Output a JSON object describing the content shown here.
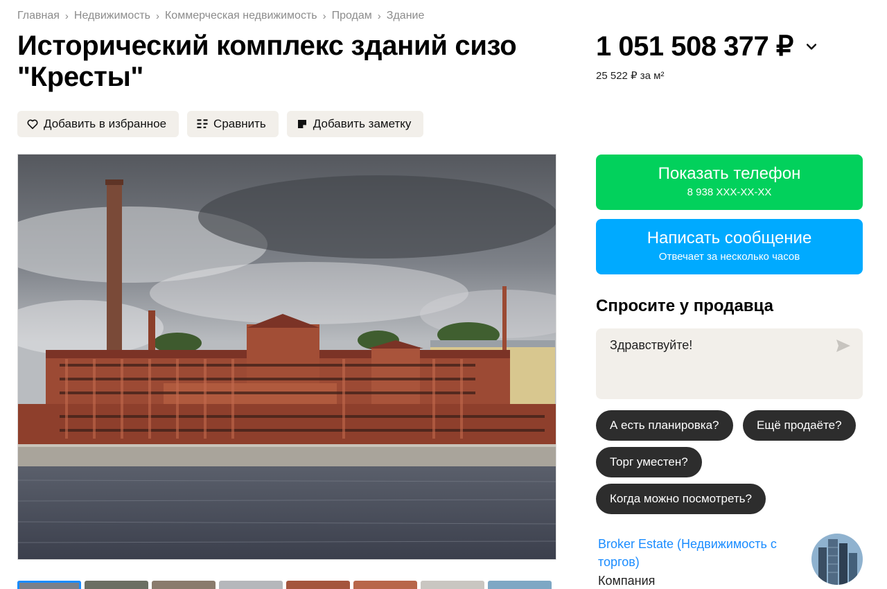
{
  "breadcrumb": [
    {
      "label": "Главная"
    },
    {
      "label": "Недвижимость"
    },
    {
      "label": "Коммерческая недвижимость"
    },
    {
      "label": "Продам"
    },
    {
      "label": "Здание"
    }
  ],
  "breadcrumb_separator": "›",
  "title": "Исторический комплекс зданий сизо \"Кресты\"",
  "actions": {
    "favorite": {
      "label": "Добавить в избранное",
      "icon": "heart-icon"
    },
    "compare": {
      "label": "Сравнить",
      "icon": "compare-icon"
    },
    "note": {
      "label": "Добавить заметку",
      "icon": "note-icon"
    }
  },
  "price": {
    "value": "1 051 508 377 ₽",
    "per_sqm": "25 522 ₽ за м²"
  },
  "phone_button": {
    "label": "Показать телефон",
    "number": "8 938 XXX-XX-XX",
    "color": "#02d15c"
  },
  "message_button": {
    "label": "Написать сообщение",
    "subtitle": "Отвечает за несколько часов",
    "color": "#00aaff"
  },
  "ask_seller": {
    "title": "Спросите у продавца",
    "input_value": "Здравствуйте!",
    "quick_questions": [
      "А есть планировка?",
      "Ещё продаёте?",
      "Торг уместен?",
      "Когда можно посмотреть?"
    ]
  },
  "seller": {
    "name": "Broker Estate (Недвижимость с торгов)",
    "type": "Компания"
  },
  "gallery": {
    "thumbnail_count": 8,
    "active_index": 0
  }
}
